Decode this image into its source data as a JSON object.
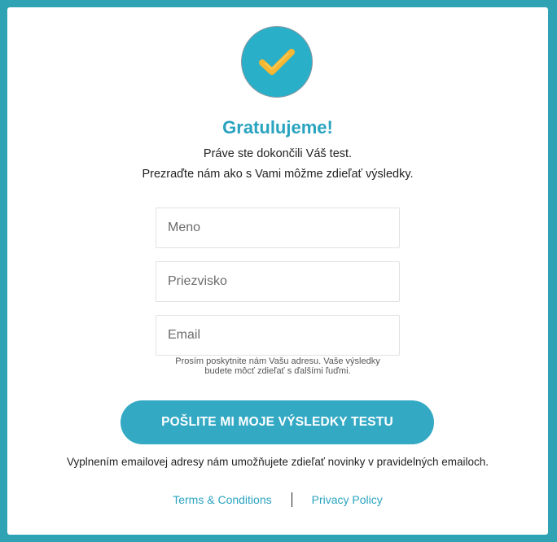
{
  "success": {
    "icon": "checkmark-icon",
    "title": "Gratulujeme!",
    "line1": "Práve ste dokončili Váš test.",
    "line2": "Prezraďte nám ako s Vami môžme zdieľať výsledky."
  },
  "form": {
    "first_name_placeholder": "Meno",
    "last_name_placeholder": "Priezvisko",
    "email_placeholder": "Email",
    "email_hint_line1": "Prosím poskytnite nám Vašu adresu. Vaše výsledky",
    "email_hint_line2": "budete môcť zdieľať s ďalšími ľuďmi.",
    "submit_label": "POŠLITE MI MOJE VÝSLEDKY TESTU"
  },
  "notice": "Vyplnením emailovej adresy nám umožňujete zdieľať novinky v pravidelných emailoch.",
  "footer": {
    "terms_label": "Terms & Conditions",
    "privacy_label": "Privacy Policy"
  },
  "colors": {
    "background": "#2fa3b3",
    "accent": "#2aa3c0",
    "button": "#34a9c4",
    "check": "#f6b733"
  }
}
